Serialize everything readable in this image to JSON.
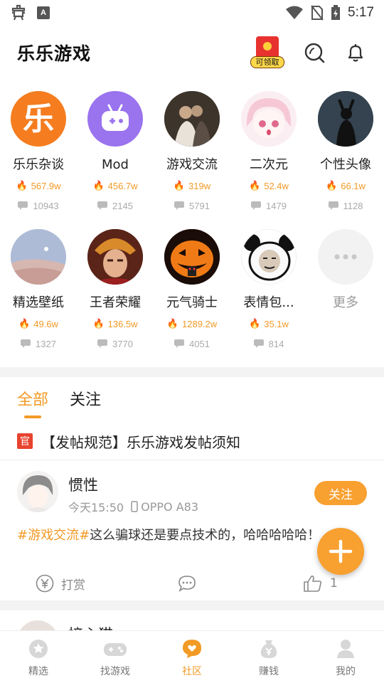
{
  "status_bar": {
    "time": "5:17"
  },
  "header": {
    "title": "乐乐游戏",
    "redpacket_label": "可领取"
  },
  "circles": [
    {
      "name": "乐乐杂谈",
      "hot": "567.9w",
      "comments": "10943",
      "icon": "le-logo-icon"
    },
    {
      "name": "Mod",
      "hot": "456.7w",
      "comments": "2145",
      "icon": "gamepad-icon"
    },
    {
      "name": "游戏交流",
      "hot": "319w",
      "comments": "5791",
      "icon": "gaming-photo"
    },
    {
      "name": "二次元",
      "hot": "52.4w",
      "comments": "1479",
      "icon": "anime-girl-photo"
    },
    {
      "name": "个性头像",
      "hot": "66.1w",
      "comments": "1128",
      "icon": "silhouette-photo"
    },
    {
      "name": "精选壁纸",
      "hot": "49.6w",
      "comments": "1327",
      "icon": "desert-photo"
    },
    {
      "name": "王者荣耀",
      "hot": "136.5w",
      "comments": "3770",
      "icon": "hero-photo"
    },
    {
      "name": "元气骑士",
      "hot": "1289.2w",
      "comments": "4051",
      "icon": "pumpkin-photo"
    },
    {
      "name": "表情包...",
      "hot": "35.1w",
      "comments": "814",
      "icon": "panda-meme-photo"
    }
  ],
  "more_label": "更多",
  "tabs": [
    {
      "label": "全部"
    },
    {
      "label": "关注"
    }
  ],
  "notice": {
    "badge": "官",
    "text": "【发帖规范】乐乐游戏发帖须知"
  },
  "post": {
    "user": "惯性",
    "time": "今天15:50",
    "device": "OPPO A83",
    "follow_label": "关注",
    "tag": "#游戏交流#",
    "text": "这么骗球还是要点技术的，哈哈哈哈哈！",
    "reward_label": "打赏",
    "like_count": "1"
  },
  "post2": {
    "user": "接心猫"
  },
  "bottom_nav": [
    {
      "label": "精选"
    },
    {
      "label": "找游戏"
    },
    {
      "label": "社区"
    },
    {
      "label": "赚钱"
    },
    {
      "label": "我的"
    }
  ],
  "colors": {
    "accent": "#f29a26",
    "fab": "#f8a030",
    "red": "#e8432f"
  }
}
